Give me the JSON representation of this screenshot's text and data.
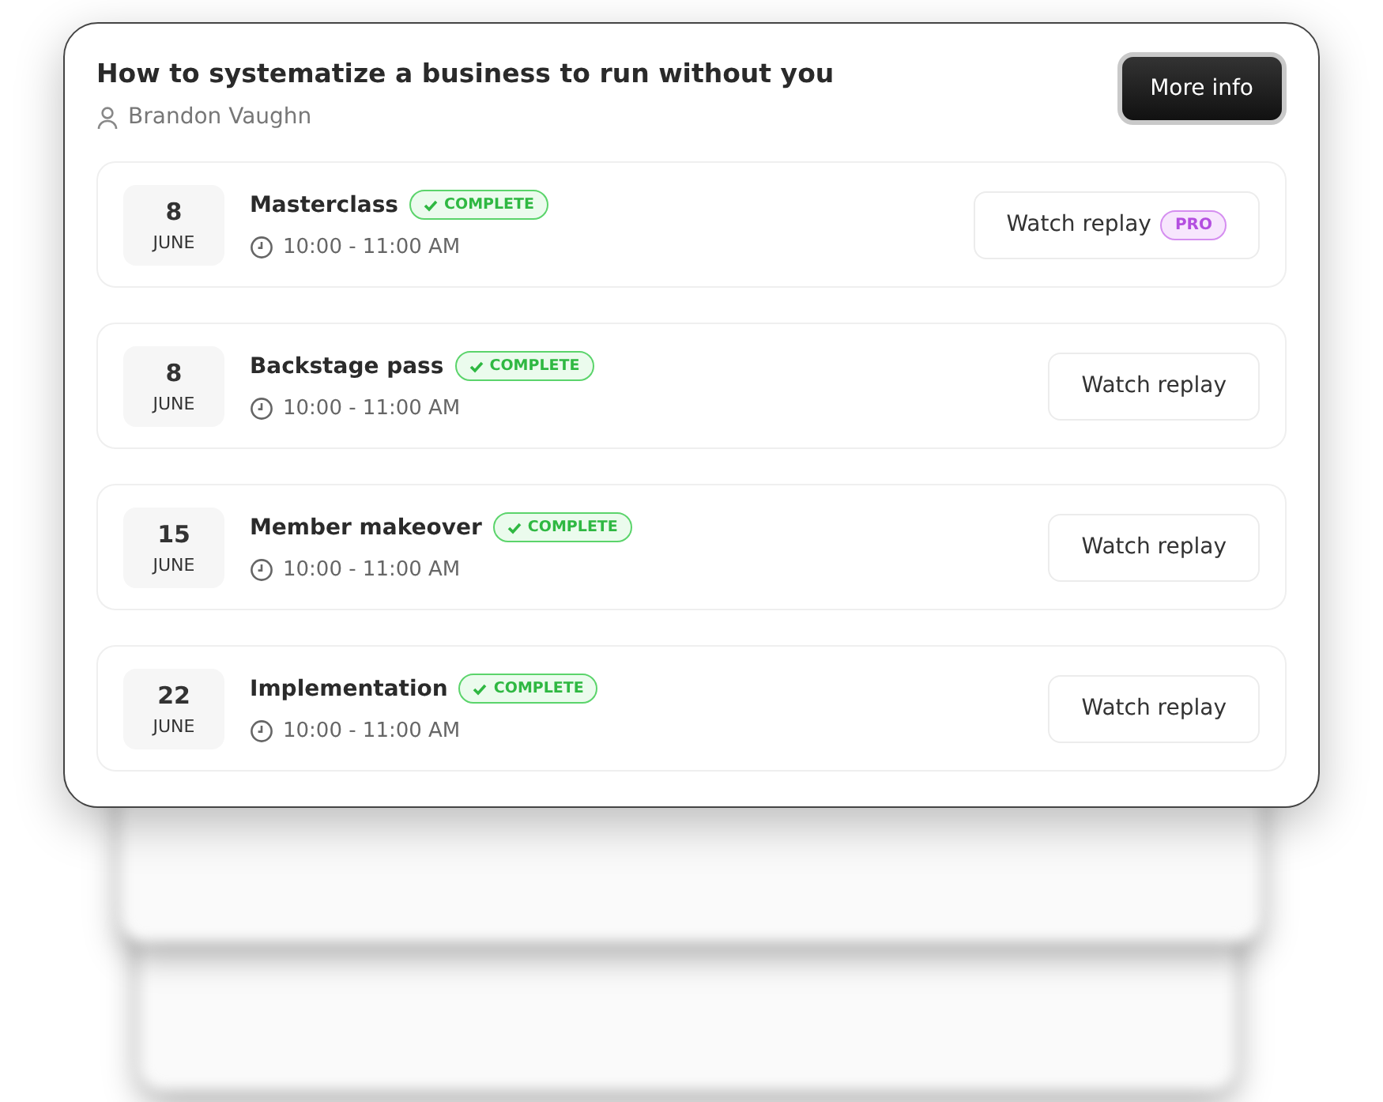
{
  "course": {
    "title": "How to systematize a business to run without you",
    "author": "Brandon Vaughn",
    "button": "More info"
  },
  "sessions": [
    {
      "day": "8",
      "month": "JUNE",
      "name": "Masterclass",
      "status": "COMPLETE",
      "time": "10:00 - 11:00 AM",
      "action": "Watch replay",
      "badge": "PRO"
    },
    {
      "day": "8",
      "month": "JUNE",
      "name": "Backstage pass",
      "status": "COMPLETE",
      "time": "10:00 - 11:00 AM",
      "action": "Watch replay"
    },
    {
      "day": "15",
      "month": "JUNE",
      "name": "Member makeover",
      "status": "COMPLETE",
      "time": "10:00 - 11:00 AM",
      "action": "Watch replay"
    },
    {
      "day": "22",
      "month": "JUNE",
      "name": "Implementation",
      "status": "COMPLETE",
      "time": "10:00 - 11:00 AM",
      "action": "Watch replay"
    }
  ]
}
